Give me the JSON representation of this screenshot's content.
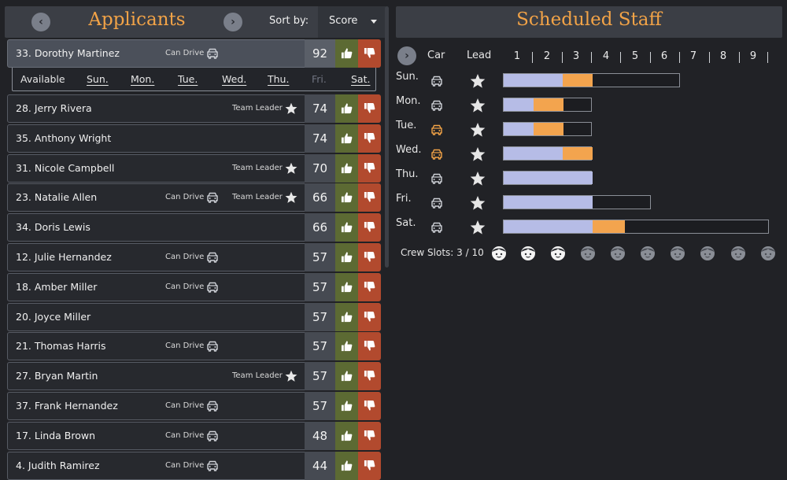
{
  "applicants": {
    "title": "Applicants",
    "sort_label": "Sort by:",
    "sort_value": "Score",
    "tags": {
      "car": "Can Drive",
      "lead": "Team Leader"
    },
    "rows": [
      {
        "name": "33. Dorothy Martinez",
        "score": "92",
        "car": true,
        "lead": false,
        "selected": true
      },
      {
        "name": "28. Jerry Rivera",
        "score": "74",
        "car": false,
        "lead": true
      },
      {
        "name": "35. Anthony Wright",
        "score": "74",
        "car": false,
        "lead": false
      },
      {
        "name": "31. Nicole Campbell",
        "score": "70",
        "car": false,
        "lead": true
      },
      {
        "name": "23. Natalie Allen",
        "score": "66",
        "car": true,
        "lead": true
      },
      {
        "name": "34. Doris Lewis",
        "score": "66",
        "car": false,
        "lead": false
      },
      {
        "name": "12. Julie Hernandez",
        "score": "57",
        "car": true,
        "lead": false
      },
      {
        "name": "18. Amber Miller",
        "score": "57",
        "car": true,
        "lead": false
      },
      {
        "name": "20. Joyce Miller",
        "score": "57",
        "car": false,
        "lead": false
      },
      {
        "name": "21. Thomas Harris",
        "score": "57",
        "car": true,
        "lead": false
      },
      {
        "name": "27. Bryan Martin",
        "score": "57",
        "car": false,
        "lead": true
      },
      {
        "name": "37. Frank Hernandez",
        "score": "57",
        "car": true,
        "lead": false
      },
      {
        "name": "17. Linda Brown",
        "score": "48",
        "car": true,
        "lead": false
      },
      {
        "name": "4. Judith Ramirez",
        "score": "44",
        "car": true,
        "lead": false
      }
    ],
    "availability": {
      "label": "Available",
      "days": [
        {
          "label": "Sun.",
          "on": true
        },
        {
          "label": "Mon.",
          "on": true
        },
        {
          "label": "Tue.",
          "on": true
        },
        {
          "label": "Wed.",
          "on": true
        },
        {
          "label": "Thu.",
          "on": true
        },
        {
          "label": "Fri.",
          "on": false
        },
        {
          "label": "Sat.",
          "on": true
        }
      ]
    }
  },
  "staff": {
    "title": "Scheduled Staff",
    "col_car": "Car",
    "col_lead": "Lead",
    "numbers": [
      "1",
      "2",
      "3",
      "4",
      "5",
      "6",
      "7",
      "8",
      "9"
    ],
    "days": [
      {
        "label": "Sun.",
        "car_color": "#cfd2d8",
        "capacity": 6,
        "filled": 2,
        "extra": 1
      },
      {
        "label": "Mon.",
        "car_color": "#cfd2d8",
        "capacity": 3,
        "filled": 1,
        "extra": 1
      },
      {
        "label": "Tue.",
        "car_color": "#f2a347",
        "capacity": 3,
        "filled": 1,
        "extra": 1
      },
      {
        "label": "Wed.",
        "car_color": "#f2a347",
        "capacity": 3,
        "filled": 2,
        "extra": 1
      },
      {
        "label": "Thu.",
        "car_color": "#cfd2d8",
        "capacity": 3,
        "filled": 3,
        "extra": 0
      },
      {
        "label": "Fri.",
        "car_color": "#cfd2d8",
        "capacity": 5,
        "filled": 3,
        "extra": 0
      },
      {
        "label": "Sat.",
        "car_color": "#cfd2d8",
        "capacity": 9,
        "filled": 3,
        "extra": 1.1
      }
    ],
    "crew_label": "Crew Slots: 3 / 10",
    "crew_total": 10,
    "crew_filled": 3
  },
  "colors": {
    "accent": "#f2a347",
    "up": "#5c6a33",
    "down": "#b24a2e",
    "bar_base": "#b6bce6",
    "bar_extra": "#f3a44e"
  }
}
